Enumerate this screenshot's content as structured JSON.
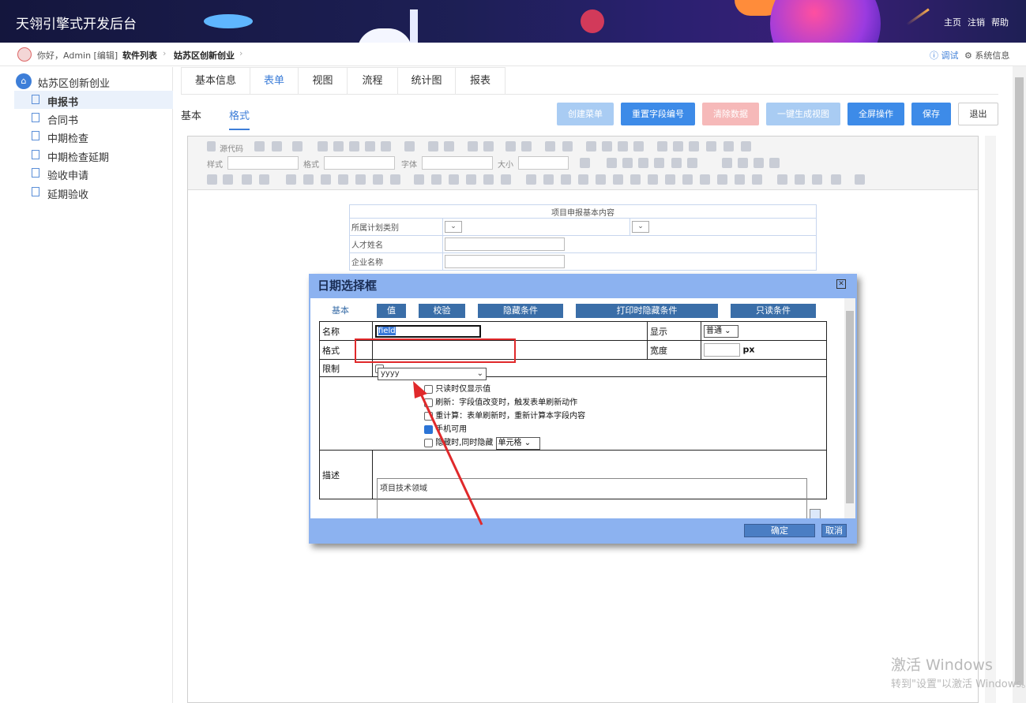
{
  "header": {
    "title": "天翎引擎式开发后台",
    "links": [
      "主页",
      "注销",
      "帮助"
    ]
  },
  "crumb": {
    "hello": "你好，Admin [编辑]",
    "items": [
      "软件列表",
      "姑苏区创新创业"
    ],
    "debug": "ⓘ 调试",
    "sysinfo": "⚙ 系统信息"
  },
  "sidebar": {
    "root": "姑苏区创新创业",
    "items": [
      {
        "label": "申报书",
        "active": true
      },
      {
        "label": "合同书"
      },
      {
        "label": "中期检查"
      },
      {
        "label": "中期检查延期"
      },
      {
        "label": "验收申请"
      },
      {
        "label": "延期验收"
      }
    ]
  },
  "tabs": [
    {
      "label": "基本信息"
    },
    {
      "label": "表单",
      "active": true
    },
    {
      "label": "视图"
    },
    {
      "label": "流程"
    },
    {
      "label": "统计图"
    },
    {
      "label": "报表"
    }
  ],
  "subtabs": [
    {
      "label": "基本"
    },
    {
      "label": "格式",
      "active": true
    }
  ],
  "actions": {
    "create_menu": "创建菜单",
    "reset_field_no": "重置字段编号",
    "clear_data": "清除数据",
    "gen_view": "一键生成视图",
    "fullscreen": "全屏操作",
    "save": "保存",
    "exit": "退出"
  },
  "toolbar": {
    "source": "源代码",
    "style": "样式",
    "format": "格式",
    "font": "字体",
    "size": "大小"
  },
  "form_preview": {
    "title": "项目申报基本内容",
    "rows": [
      "所属计划类别",
      "人才姓名",
      "企业名称"
    ]
  },
  "dialog": {
    "title": "日期选择框",
    "tabs": [
      "基本",
      "值",
      "校验",
      "隐藏条件",
      "打印时隐藏条件",
      "只读条件"
    ],
    "name_label": "名称",
    "name_value": "field",
    "display_label": "显示",
    "display_value": "普通",
    "format_label": "格式",
    "format_value": "yyyy",
    "width_label": "宽度",
    "width_unit": "px",
    "limit_label": "限制",
    "options": [
      {
        "text": "只读时仅显示值",
        "checked": false
      },
      {
        "text": "刷新：字段值改变时，触发表单刷新动作",
        "checked": false
      },
      {
        "text": "重计算：表单刷新时，重新计算本字段内容",
        "checked": false
      },
      {
        "text": "手机可用",
        "checked": true
      },
      {
        "text": "隐藏时,同时隐藏",
        "checked": false
      }
    ],
    "hide_target": "单元格",
    "desc_label": "描述",
    "desc_value": "项目技术领域",
    "ok": "确定",
    "cancel": "取消"
  },
  "watermark": {
    "line1": "激活 Windows",
    "line2": "转到\"设置\"以激活 Windows。"
  }
}
